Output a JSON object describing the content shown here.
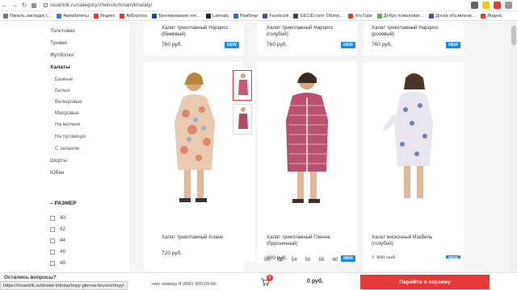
{
  "browser": {
    "url": "insantrik.ru/category/zhenshchinam/khalaty/",
    "bookmarks": [
      {
        "label": "Панель закладок (…",
        "color": "#777"
      },
      {
        "label": "Авиабилеты",
        "color": "#3f7be6"
      },
      {
        "label": "Яндекс",
        "color": "#e53935"
      },
      {
        "label": "AliExpress",
        "color": "#e53935"
      },
      {
        "label": "Бронирование оте…",
        "color": "#1a4b9c"
      },
      {
        "label": "Lamoda",
        "color": "#222"
      },
      {
        "label": "Рамблер",
        "color": "#2e63d0"
      },
      {
        "label": "Facebook",
        "color": "#3b5998"
      },
      {
        "label": "GECID.com: Обзор…",
        "color": "#444"
      },
      {
        "label": "YouTube",
        "color": "#e53935"
      },
      {
        "label": "Добро пожаловат…",
        "color": "#6aa84f"
      },
      {
        "label": "Доска объявлени…",
        "color": "#3b5998"
      },
      {
        "label": "Яндекс",
        "color": "#e53935"
      }
    ]
  },
  "sidebar": {
    "categories": [
      "Толстовки",
      "Туники",
      "Футболки"
    ],
    "active": "Халаты",
    "subcategories": [
      "Банные",
      "Белые",
      "Велюровые",
      "Махровые",
      "На молнии",
      "На пуговицах",
      "С запахом"
    ],
    "after": [
      "Шорты",
      "Юбки"
    ],
    "size_title": "РАЗМЕР",
    "sizes": [
      "40",
      "42",
      "44",
      "46",
      "48"
    ]
  },
  "products_top": [
    {
      "title": "Халат трикотажный Нарцисс (бежевый)",
      "price": "760 руб.",
      "badge": "NEW"
    },
    {
      "title": "Халат трикотажный Нарцисс (голубой)",
      "price": "760 руб.",
      "badge": "NEW"
    },
    {
      "title": "Халат трикотажный Нарцисс (розовый)",
      "price": "760 руб.",
      "badge": "NEW"
    }
  ],
  "products": [
    {
      "title": "Халат трикотажный Аланн",
      "price": "720 руб.",
      "badge": ""
    },
    {
      "title": "Халат трикотажный Гленна (брусничный)",
      "price": "800 руб.",
      "badge": "NEW"
    },
    {
      "title": "Халат вискозный Изабель (голубой)",
      "price": "1 390 руб.",
      "badge": "NEW"
    }
  ],
  "hover_sizes": [
    "50",
    "52",
    "54",
    "56",
    "58",
    "60"
  ],
  "bottom": {
    "questions": "Остались вопросы?",
    "status_url": "https://insantrik.ru/khalat-trikotazhnyy-glenna-brusnichnyy/",
    "phone_text": "ому номеру 8 (800) 200-09-66.",
    "cart_count": "0",
    "total": "0 руб.",
    "add_to_cart": "Перейти в корзину"
  },
  "colors": {
    "accent": "#e53935",
    "badge": "#1e88e5"
  }
}
